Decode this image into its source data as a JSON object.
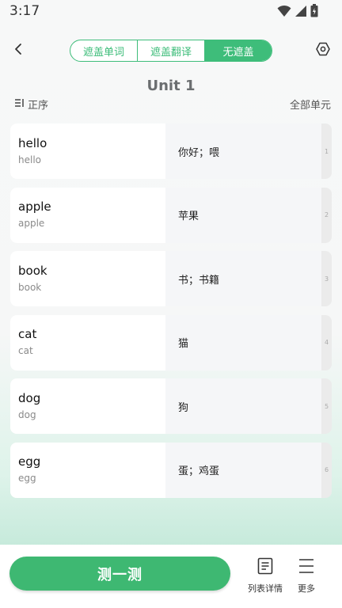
{
  "status": {
    "time": "3:17"
  },
  "header": {
    "tabs": [
      {
        "label": "遮盖单词",
        "active": false
      },
      {
        "label": "遮盖翻译",
        "active": false
      },
      {
        "label": "无遮盖",
        "active": true
      }
    ]
  },
  "unit": {
    "title": "Unit 1"
  },
  "sort": {
    "label": "正序"
  },
  "all_units": "全部单元",
  "words": [
    {
      "word": "hello",
      "sub": "hello",
      "meaning": "你好；喂",
      "index": "1"
    },
    {
      "word": "apple",
      "sub": "apple",
      "meaning": "苹果",
      "index": "2"
    },
    {
      "word": "book",
      "sub": "book",
      "meaning": "书；书籍",
      "index": "3"
    },
    {
      "word": "cat",
      "sub": "cat",
      "meaning": "猫",
      "index": "4"
    },
    {
      "word": "dog",
      "sub": "dog",
      "meaning": "狗",
      "index": "5"
    },
    {
      "word": "egg",
      "sub": "egg",
      "meaning": "蛋；鸡蛋",
      "index": "6"
    }
  ],
  "bottom": {
    "test_label": "测一测",
    "list_detail_label": "列表详情",
    "more_label": "更多"
  },
  "colors": {
    "accent": "#3ebd7a",
    "button": "#3eb872"
  }
}
